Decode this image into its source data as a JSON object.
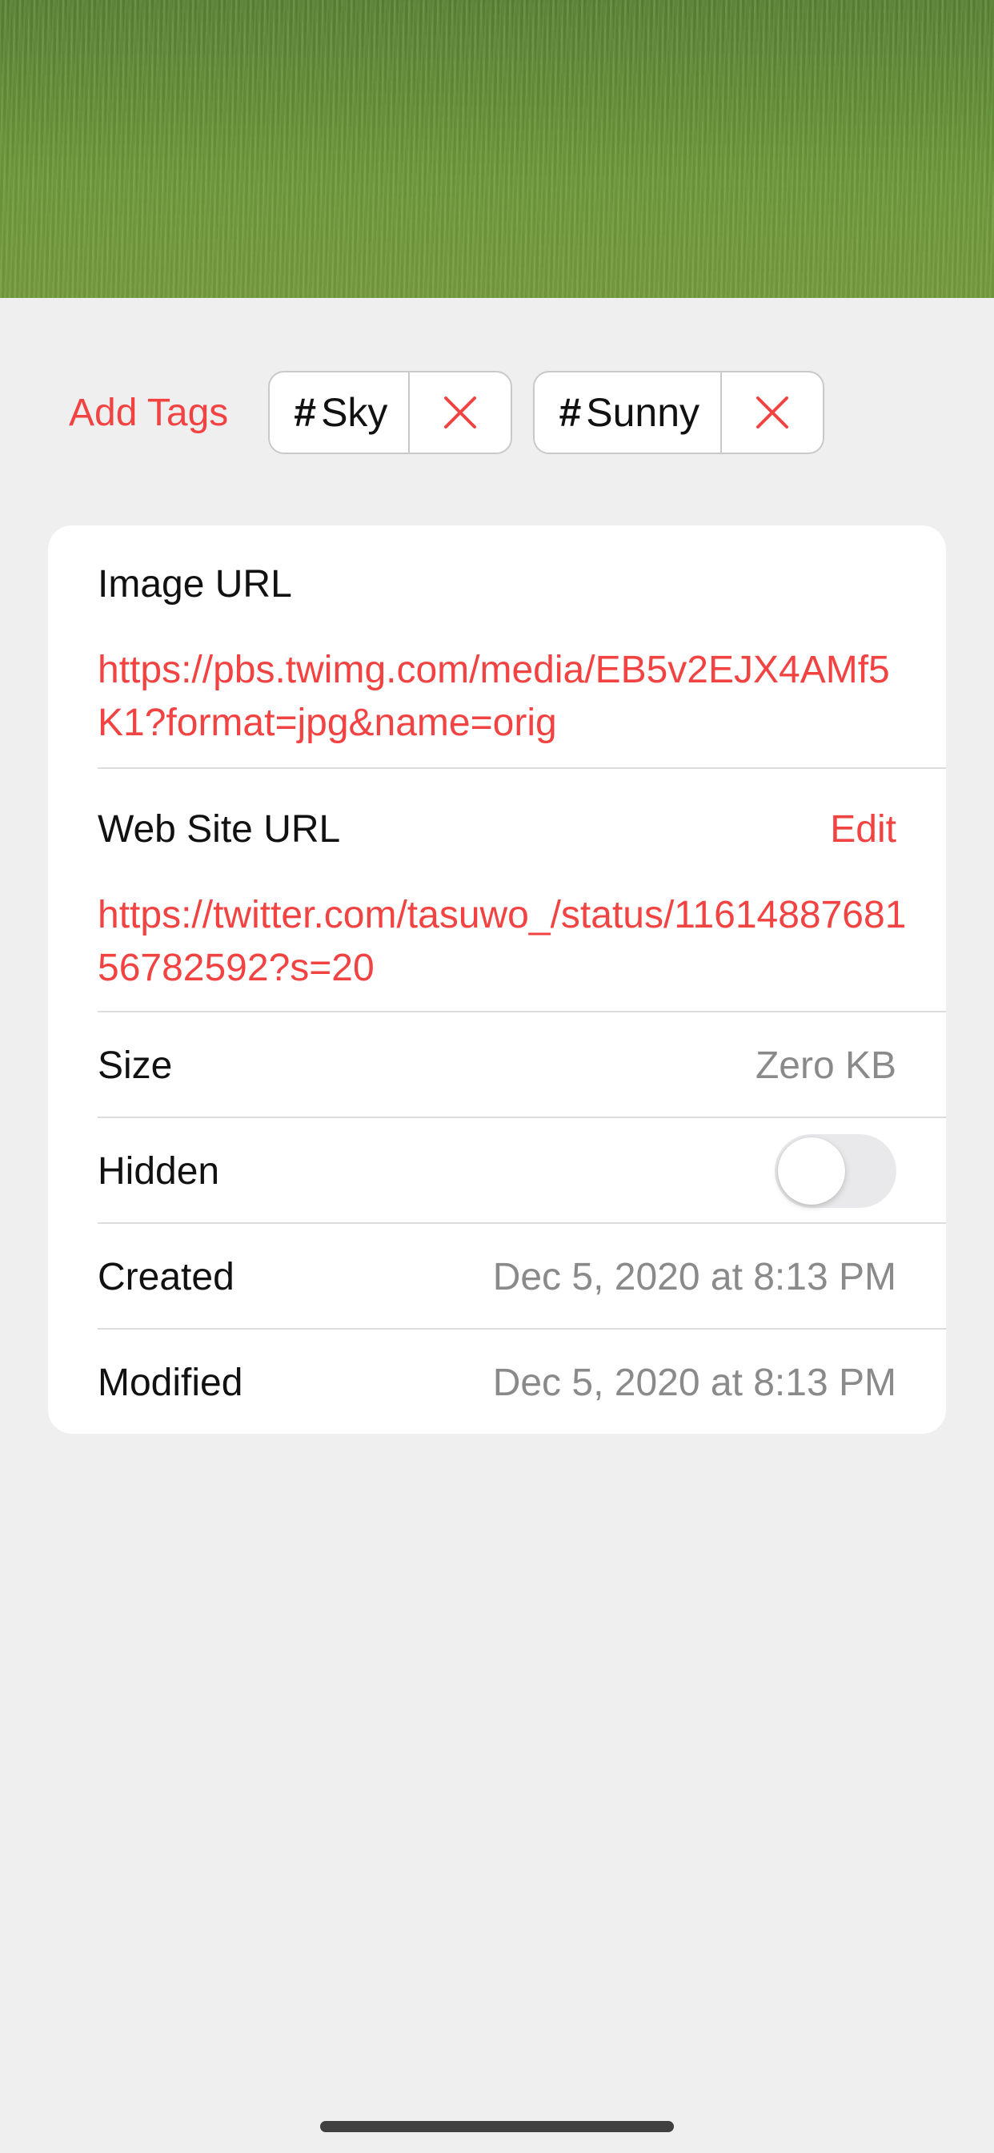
{
  "tags": {
    "add_label": "Add Tags",
    "items": [
      {
        "hash": "#",
        "label": "Sky"
      },
      {
        "hash": "#",
        "label": "Sunny"
      }
    ]
  },
  "details": {
    "image_url": {
      "label": "Image URL",
      "value": "https://pbs.twimg.com/media/EB5v2EJX4AMf5K1?format=jpg&name=orig"
    },
    "web_site_url": {
      "label": "Web Site URL",
      "edit_label": "Edit",
      "value": "https://twitter.com/tasuwo_/status/1161488768156782592?s=20"
    },
    "size": {
      "label": "Size",
      "value": "Zero KB"
    },
    "hidden": {
      "label": "Hidden",
      "on": false
    },
    "created": {
      "label": "Created",
      "value": "Dec 5, 2020 at 8:13 PM"
    },
    "modified": {
      "label": "Modified",
      "value": "Dec 5, 2020 at 8:13 PM"
    }
  },
  "colors": {
    "accent": "#f24343",
    "background": "#efefef",
    "card": "#ffffff",
    "secondary_text": "#8a8a8a"
  },
  "icons": {
    "tag_remove": "close-icon"
  }
}
